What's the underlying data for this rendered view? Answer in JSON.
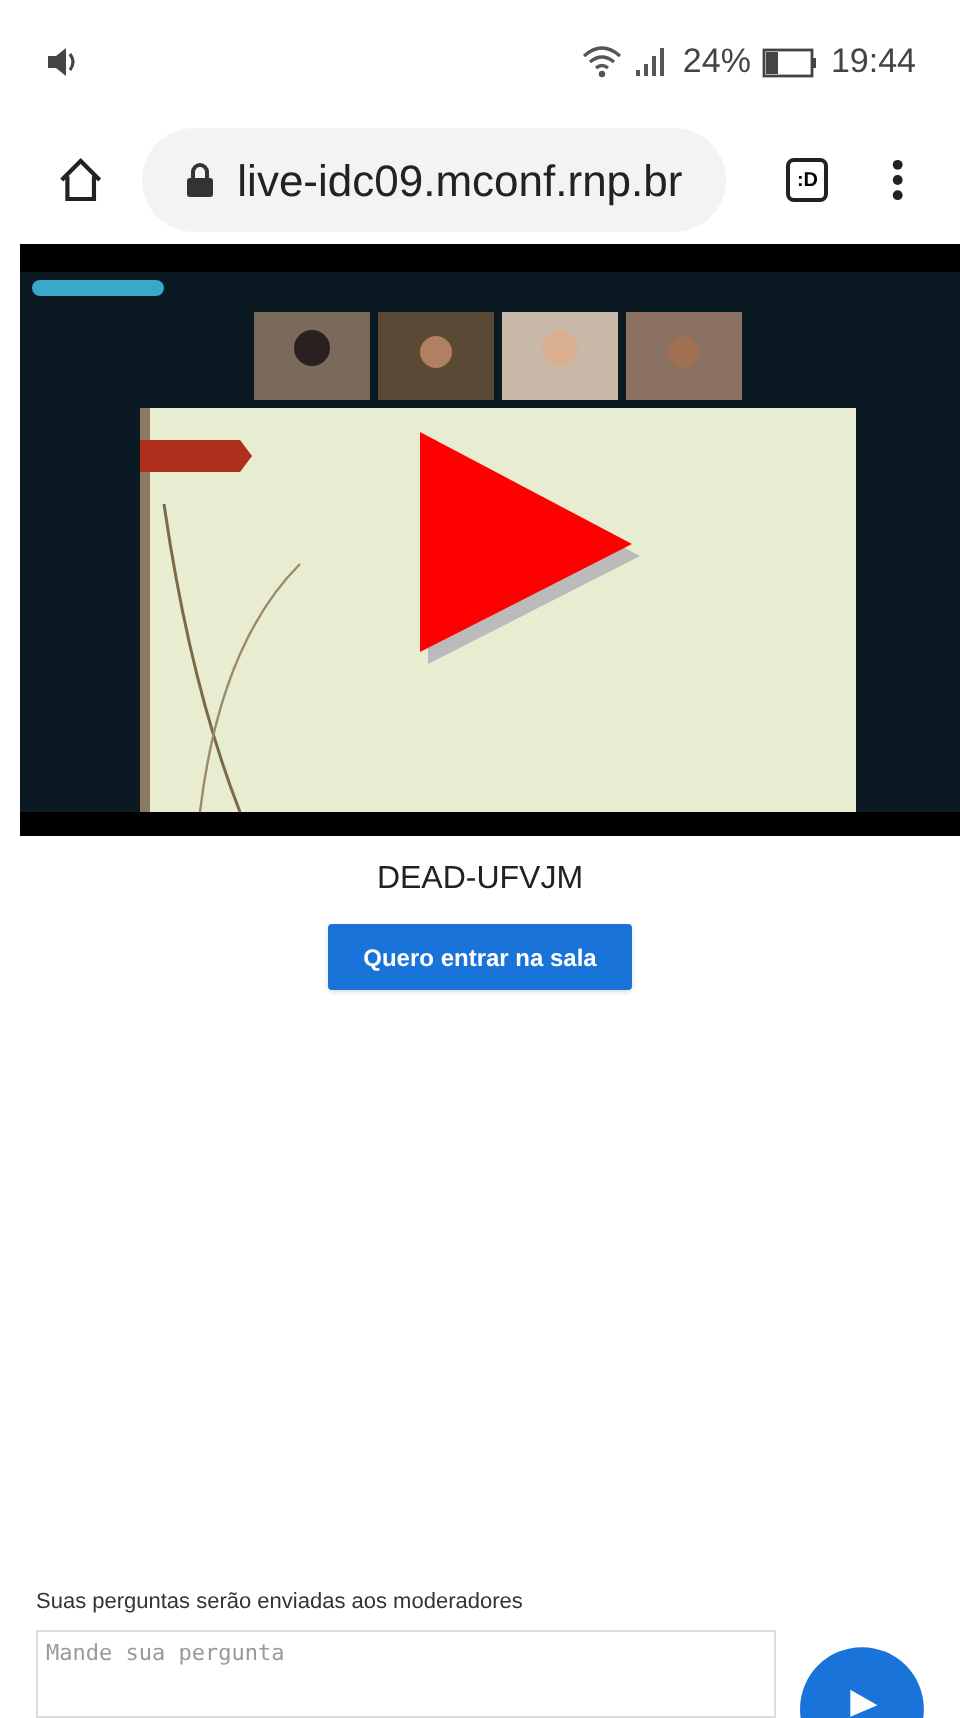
{
  "status_bar": {
    "battery": "24%",
    "time": "19:44"
  },
  "browser": {
    "url": "live-idc09.mconf.rnp.br",
    "tab_icon": ":D"
  },
  "stream": {
    "title": "DEAD-UFVJM",
    "button": "Quero entrar na sala"
  },
  "question": {
    "label": "Suas perguntas serão enviadas aos moderadores",
    "placeholder": "Mande sua pergunta"
  }
}
